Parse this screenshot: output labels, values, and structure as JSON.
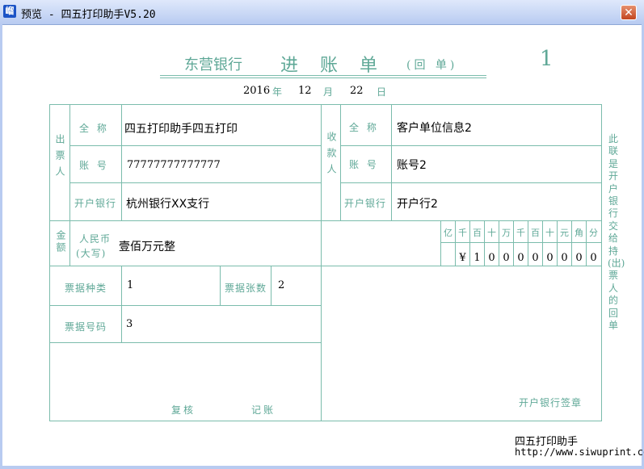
{
  "window": {
    "title": "预览 - 四五打印助手V5.20",
    "icon": "app-icon",
    "icon_glyph": "嵧",
    "close_glyph": "✕"
  },
  "slip": {
    "bank_name": "东营银行",
    "form_title": "进 账 单",
    "form_subtitle": "(回 单)",
    "copy_number": "1",
    "date": {
      "year": "2016",
      "year_label": "年",
      "month": "12",
      "month_label": "月",
      "day": "22",
      "day_label": "日"
    },
    "payer": {
      "section_label": "出票人",
      "name_label": "全 称",
      "name_value": "四五打印助手四五打印",
      "account_label": "账 号",
      "account_value": "77777777777777",
      "bank_label": "开户银行",
      "bank_value": "杭州银行XX支行"
    },
    "payee": {
      "section_label": "收款人",
      "name_label": "全 称",
      "name_value": "客户单位信息2",
      "account_label": "账 号",
      "account_value": "账号2",
      "bank_label": "开户银行",
      "bank_value": "开户行2"
    },
    "amount": {
      "section_label": "金额",
      "currency_label_line1": "人民币",
      "currency_label_line2": "(大写)",
      "in_words": "壹佰万元整",
      "digit_headers": [
        "亿",
        "千",
        "百",
        "十",
        "万",
        "千",
        "百",
        "十",
        "元",
        "角",
        "分"
      ],
      "digits": [
        "",
        "¥",
        "1",
        "0",
        "0",
        "0",
        "0",
        "0",
        "0",
        "0",
        "0"
      ]
    },
    "bill_type_label": "票据种类",
    "bill_type_value": "1",
    "bill_count_label": "票据张数",
    "bill_count_value": "2",
    "bill_number_label": "票据号码",
    "bill_number_value": "3",
    "review_label": "复核",
    "bookkeeping_label": "记账",
    "bank_seal_label": "开户银行签章",
    "side_note": "此联是开户银行交给持(出)票人的回单"
  },
  "watermark": {
    "name": "四五打印助手",
    "url": "http://www.siwuprint.co"
  },
  "colors": {
    "form_green": "#5fa897",
    "line_green": "#7bbcac",
    "titlebar_top": "#dfe8fb",
    "titlebar_bottom": "#b8cbf1",
    "close_red": "#c2461f"
  }
}
